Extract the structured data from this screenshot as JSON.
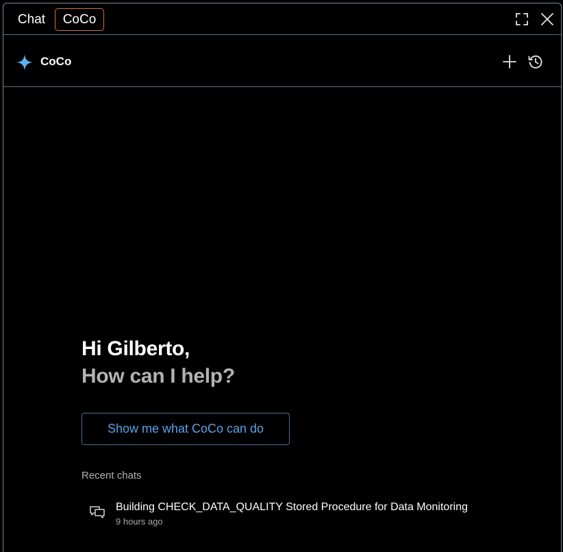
{
  "tabs": {
    "chat_label": "Chat",
    "coco_label": "CoCo"
  },
  "header": {
    "title": "CoCo"
  },
  "main": {
    "greeting": "Hi Gilberto,",
    "prompt": "How can I help?",
    "cta_label": "Show me what CoCo can do",
    "recent_label": "Recent chats",
    "recent_chats": [
      {
        "title": "Building CHECK_DATA_QUALITY Stored Procedure for Data Monitoring",
        "time": "9 hours ago"
      }
    ]
  },
  "icons": {
    "brand": "sparkle-icon",
    "expand": "expand-icon",
    "close": "close-icon",
    "new_chat": "plus-icon",
    "history": "history-icon",
    "chat": "chat-bubbles-icon"
  },
  "colors": {
    "background": "#000000",
    "active_tab_border": "#d4733a",
    "accent": "#5aa2e6",
    "brand_icon": "#5ab0f0"
  }
}
